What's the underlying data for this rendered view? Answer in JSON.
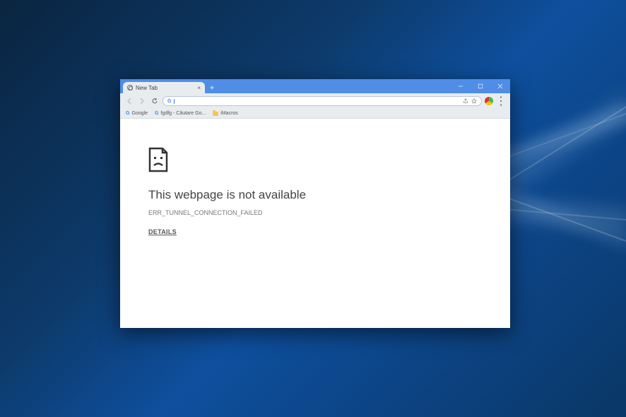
{
  "tab": {
    "title": "New Tab"
  },
  "omnibox": {
    "search_hint": "G",
    "value": ""
  },
  "bookmarks": [
    {
      "label": "Google",
      "icon": "google"
    },
    {
      "label": "fgdfg - Căutare Go...",
      "icon": "google"
    },
    {
      "label": "iMacros",
      "icon": "folder"
    }
  ],
  "error": {
    "title": "This webpage is not available",
    "code": "ERR_TUNNEL_CONNECTION_FAILED",
    "details_label": "DETAILS"
  }
}
